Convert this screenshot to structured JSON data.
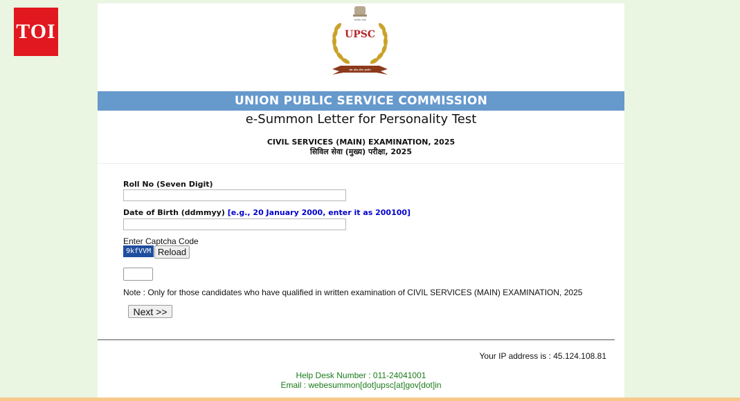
{
  "toi_badge": "TOI",
  "logo": {
    "text": "UPSC",
    "ribbon_text": "संघ लोक सेवा आयोग",
    "motto": "सत्यमेव जयते"
  },
  "header": {
    "commission_title": "UNION PUBLIC SERVICE COMMISSION",
    "page_title": "e-Summon Letter for Personality Test",
    "exam_name_en": "CIVIL SERVICES (MAIN) EXAMINATION, 2025",
    "exam_name_hi": "सिविल सेवा (मुख्य) परीक्षा, 2025"
  },
  "form": {
    "roll_no_label": "Roll No (Seven Digit)",
    "roll_no_value": "",
    "dob_label": "Date of Birth (ddmmyy)",
    "dob_hint": "[e.g., 20 January 2000, enter it as 200100]",
    "dob_value": "",
    "captcha_label": "Enter Captcha Code",
    "captcha_code": "9kfVVM",
    "reload_label": "Reload",
    "captcha_value": "",
    "note": "Note : Only for those candidates who have qualified in written examination of CIVIL SERVICES (MAIN) EXAMINATION, 2025",
    "next_label": "Next >>"
  },
  "footer": {
    "ip_text": "Your IP address is : 45.124.108.81",
    "helpdesk": "Help Desk Number : 011-24041001",
    "email": "Email : webesummon[dot]upsc[at]gov[dot]in"
  },
  "colors": {
    "banner": "#6699cc",
    "toi_red": "#e1181f",
    "captcha_bg": "#1f4e9e",
    "helpdesk_green": "#1a7a1a",
    "hint_blue": "#0000cc"
  }
}
